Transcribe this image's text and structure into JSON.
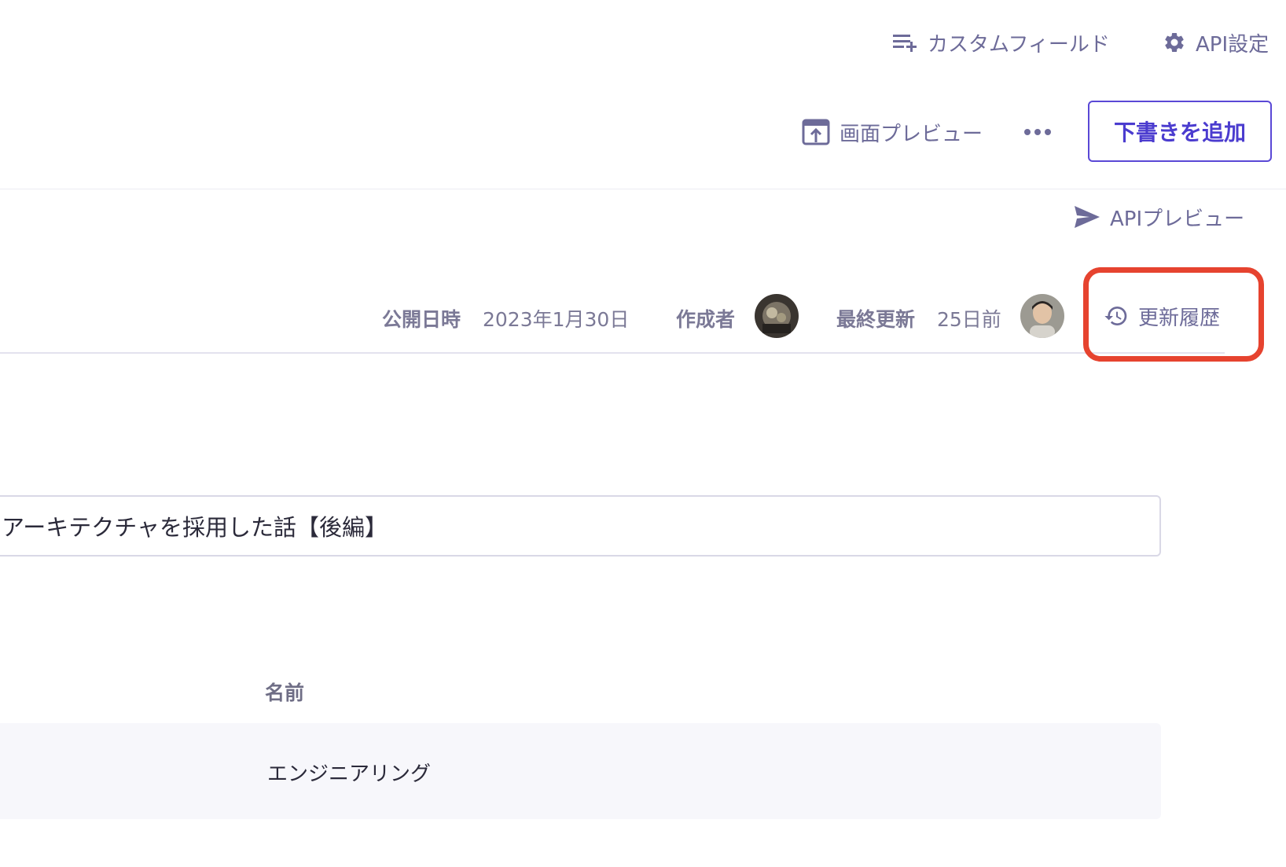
{
  "header": {
    "custom_field_label": "カスタムフィールド",
    "api_settings_label": "API設定"
  },
  "toolbar": {
    "screen_preview_label": "画面プレビュー",
    "add_draft_label": "下書きを追加",
    "api_preview_label": "APIプレビュー"
  },
  "meta": {
    "published_label": "公開日時",
    "published_value": "2023年1月30日",
    "author_label": "作成者",
    "updated_label": "最終更新",
    "updated_value": "25日前",
    "history_label": "更新履歴"
  },
  "content": {
    "title_value": "アーキテクチャを採用した話【後編】"
  },
  "table": {
    "name_header": "名前",
    "rows": [
      {
        "name": "エンジニアリング"
      }
    ]
  },
  "colors": {
    "accent": "#4b3ccf",
    "icon": "#6d6b99",
    "highlight": "#e6432f"
  }
}
